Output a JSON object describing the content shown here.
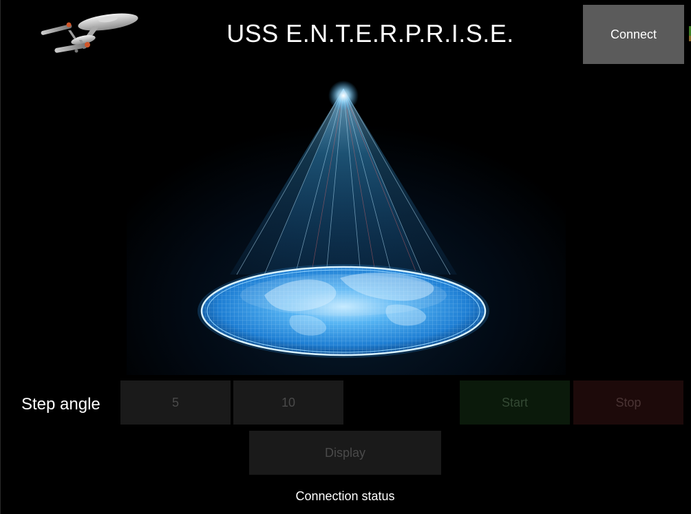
{
  "header": {
    "title": "USS E.N.T.E.R.P.R.I.S.E.",
    "connect_label": "Connect",
    "logo_icon": "starship-enterprise-icon"
  },
  "main": {
    "hologram_icon": "hologram-projection-icon"
  },
  "controls": {
    "step_label": "Step angle",
    "step_options": [
      "5",
      "10"
    ],
    "start_label": "Start",
    "stop_label": "Stop",
    "display_label": "Display"
  },
  "status": {
    "text": "Connection status"
  },
  "colors": {
    "background": "#000000",
    "connect_button": "#5b5b5b",
    "disabled_button": "#1a1a1a",
    "start_button": "#0b1a0b",
    "stop_button": "#1d0a0a",
    "hologram": "#3fa9ff"
  }
}
